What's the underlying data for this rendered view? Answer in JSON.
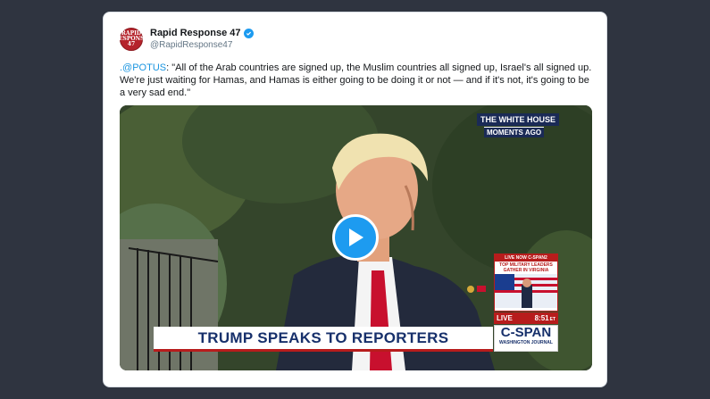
{
  "tweet": {
    "avatar_text": "RAPID RESPONSE 47",
    "author_name": "Rapid Response 47",
    "author_handle": "@RapidResponse47",
    "mention": ".@POTUS",
    "text": ": \"All of the Arab countries are signed up, the Muslim countries all signed up, Israel's all signed up. We're just waiting for Hamas, and Hamas is either going to be doing it or not — and if it's not, it's going to be a very sad end.\""
  },
  "video": {
    "tag_location": "THE WHITE HOUSE",
    "tag_time": "MOMENTS AGO",
    "lower_third": "TRUMP SPEAKS TO REPORTERS",
    "live_now": "LIVE NOW C-SPAN2",
    "live_headline": "TOP MILITARY LEADERS GATHER IN VIRGINIA",
    "live_label": "LIVE",
    "clock": "8:51",
    "clock_suffix": "ET",
    "network_logo": "C-SPAN",
    "network_sub": "WASHINGTON JOURNAL"
  },
  "colors": {
    "page_bg": "#2f3440",
    "accent_blue": "#1d9bf0",
    "cspan_navy": "#17306b",
    "cspan_red": "#b71c1c"
  },
  "icons": [
    "verified-badge-icon",
    "play-icon"
  ]
}
